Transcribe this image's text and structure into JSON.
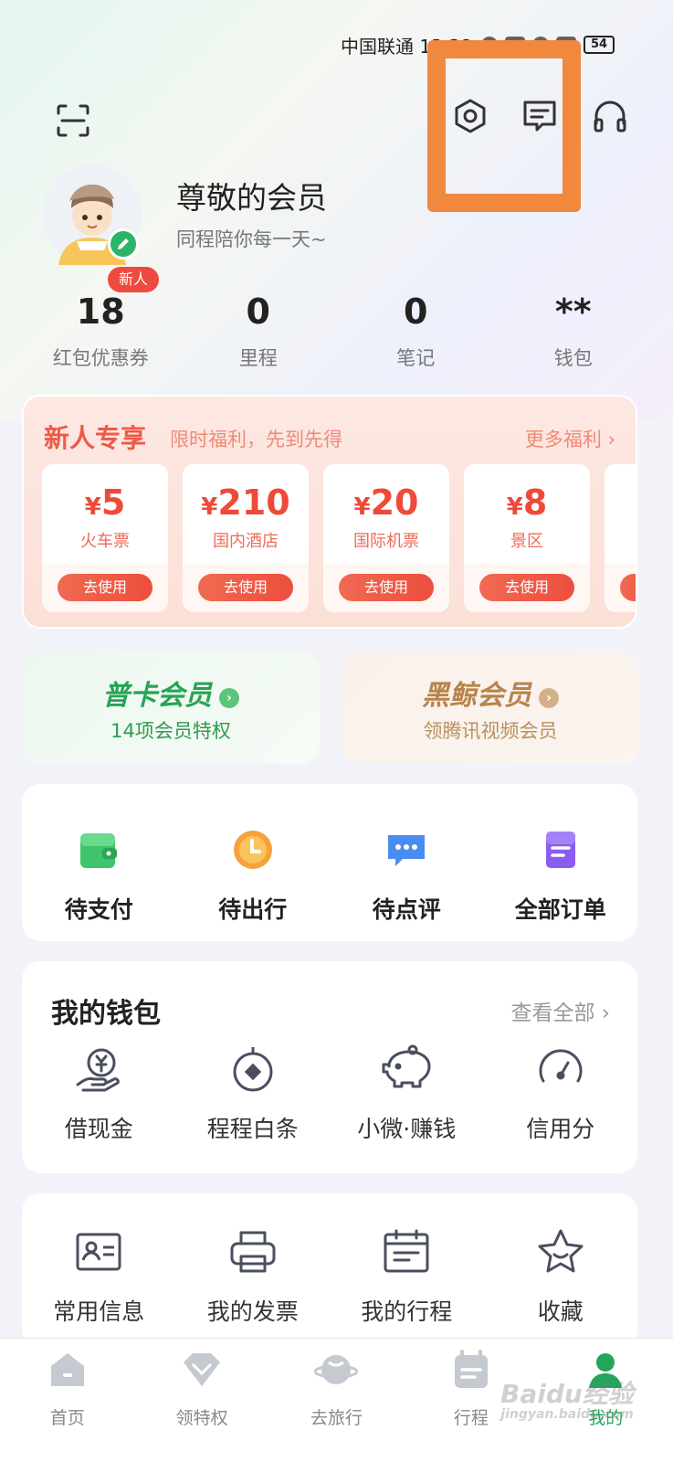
{
  "status_bar": {
    "carrier_time": "中国联通 13:38",
    "battery": "54"
  },
  "profile": {
    "name": "尊敬的会员",
    "slogan": "同程陪你每一天~",
    "new_badge": "新人"
  },
  "stats": [
    {
      "value": "18",
      "label": "红包优惠券"
    },
    {
      "value": "0",
      "label": "里程"
    },
    {
      "value": "0",
      "label": "笔记"
    },
    {
      "value": "**",
      "label": "钱包"
    }
  ],
  "newcomer": {
    "title": "新人专享",
    "subtitle": "限时福利，先到先得",
    "more": "更多福利 ›",
    "coupons": [
      {
        "currency": "¥",
        "amount": "5",
        "name": "火车票",
        "action": "去使用"
      },
      {
        "currency": "¥",
        "amount": "210",
        "name": "国内酒店",
        "action": "去使用"
      },
      {
        "currency": "¥",
        "amount": "20",
        "name": "国际机票",
        "action": "去使用"
      },
      {
        "currency": "¥",
        "amount": "8",
        "name": "景区",
        "action": "去使用"
      }
    ]
  },
  "membership": [
    {
      "title": "普卡会员",
      "subtitle": "14项会员特权",
      "color": "#26a454"
    },
    {
      "title": "黑鲸会员",
      "subtitle": "领腾讯视频会员",
      "color": "#b8844c"
    }
  ],
  "orders": [
    {
      "label": "待支付",
      "icon": "wallet-icon"
    },
    {
      "label": "待出行",
      "icon": "clock-icon"
    },
    {
      "label": "待点评",
      "icon": "comment-icon"
    },
    {
      "label": "全部订单",
      "icon": "document-icon"
    }
  ],
  "wallet": {
    "title": "我的钱包",
    "view_all": "查看全部 ›",
    "items": [
      {
        "label": "借现金",
        "icon": "cash-hand-icon"
      },
      {
        "label": "程程白条",
        "icon": "coin-icon"
      },
      {
        "label": "小微·赚钱",
        "icon": "piggy-bank-icon"
      },
      {
        "label": "信用分",
        "icon": "gauge-icon"
      }
    ]
  },
  "more_services": [
    {
      "label": "常用信息",
      "icon": "id-card-icon"
    },
    {
      "label": "我的发票",
      "icon": "printer-icon"
    },
    {
      "label": "我的行程",
      "icon": "calendar-icon"
    },
    {
      "label": "收藏",
      "icon": "star-icon"
    }
  ],
  "tabbar": [
    {
      "label": "首页",
      "icon": "home-icon"
    },
    {
      "label": "领特权",
      "icon": "diamond-icon"
    },
    {
      "label": "去旅行",
      "icon": "planet-icon"
    },
    {
      "label": "行程",
      "icon": "itinerary-icon"
    },
    {
      "label": "我的",
      "icon": "profile-icon",
      "active": true
    }
  ],
  "watermark": {
    "text": "Baidu经验",
    "url": "jingyan.baidu.com"
  },
  "colors": {
    "accent_green": "#23a65a",
    "highlight_orange": "#f0893e",
    "coupon_red": "#ee4a3a"
  }
}
